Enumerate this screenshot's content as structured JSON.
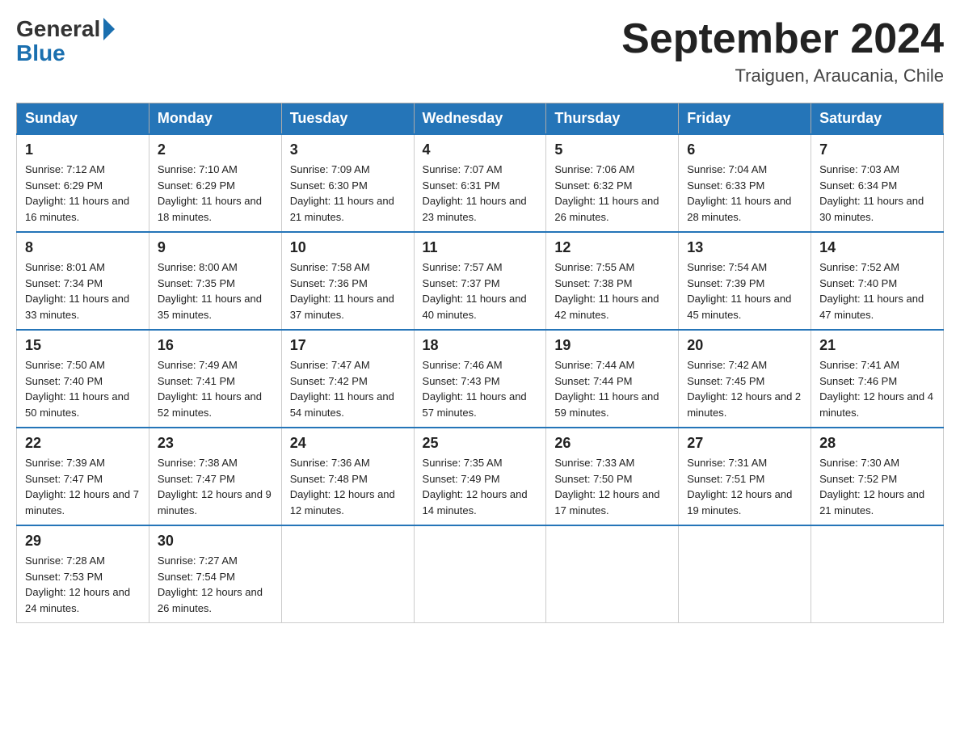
{
  "logo": {
    "general": "General",
    "blue": "Blue"
  },
  "title": {
    "month_year": "September 2024",
    "location": "Traiguen, Araucania, Chile"
  },
  "days_of_week": [
    "Sunday",
    "Monday",
    "Tuesday",
    "Wednesday",
    "Thursday",
    "Friday",
    "Saturday"
  ],
  "weeks": [
    [
      {
        "day": "1",
        "sunrise": "7:12 AM",
        "sunset": "6:29 PM",
        "daylight": "11 hours and 16 minutes."
      },
      {
        "day": "2",
        "sunrise": "7:10 AM",
        "sunset": "6:29 PM",
        "daylight": "11 hours and 18 minutes."
      },
      {
        "day": "3",
        "sunrise": "7:09 AM",
        "sunset": "6:30 PM",
        "daylight": "11 hours and 21 minutes."
      },
      {
        "day": "4",
        "sunrise": "7:07 AM",
        "sunset": "6:31 PM",
        "daylight": "11 hours and 23 minutes."
      },
      {
        "day": "5",
        "sunrise": "7:06 AM",
        "sunset": "6:32 PM",
        "daylight": "11 hours and 26 minutes."
      },
      {
        "day": "6",
        "sunrise": "7:04 AM",
        "sunset": "6:33 PM",
        "daylight": "11 hours and 28 minutes."
      },
      {
        "day": "7",
        "sunrise": "7:03 AM",
        "sunset": "6:34 PM",
        "daylight": "11 hours and 30 minutes."
      }
    ],
    [
      {
        "day": "8",
        "sunrise": "8:01 AM",
        "sunset": "7:34 PM",
        "daylight": "11 hours and 33 minutes."
      },
      {
        "day": "9",
        "sunrise": "8:00 AM",
        "sunset": "7:35 PM",
        "daylight": "11 hours and 35 minutes."
      },
      {
        "day": "10",
        "sunrise": "7:58 AM",
        "sunset": "7:36 PM",
        "daylight": "11 hours and 37 minutes."
      },
      {
        "day": "11",
        "sunrise": "7:57 AM",
        "sunset": "7:37 PM",
        "daylight": "11 hours and 40 minutes."
      },
      {
        "day": "12",
        "sunrise": "7:55 AM",
        "sunset": "7:38 PM",
        "daylight": "11 hours and 42 minutes."
      },
      {
        "day": "13",
        "sunrise": "7:54 AM",
        "sunset": "7:39 PM",
        "daylight": "11 hours and 45 minutes."
      },
      {
        "day": "14",
        "sunrise": "7:52 AM",
        "sunset": "7:40 PM",
        "daylight": "11 hours and 47 minutes."
      }
    ],
    [
      {
        "day": "15",
        "sunrise": "7:50 AM",
        "sunset": "7:40 PM",
        "daylight": "11 hours and 50 minutes."
      },
      {
        "day": "16",
        "sunrise": "7:49 AM",
        "sunset": "7:41 PM",
        "daylight": "11 hours and 52 minutes."
      },
      {
        "day": "17",
        "sunrise": "7:47 AM",
        "sunset": "7:42 PM",
        "daylight": "11 hours and 54 minutes."
      },
      {
        "day": "18",
        "sunrise": "7:46 AM",
        "sunset": "7:43 PM",
        "daylight": "11 hours and 57 minutes."
      },
      {
        "day": "19",
        "sunrise": "7:44 AM",
        "sunset": "7:44 PM",
        "daylight": "11 hours and 59 minutes."
      },
      {
        "day": "20",
        "sunrise": "7:42 AM",
        "sunset": "7:45 PM",
        "daylight": "12 hours and 2 minutes."
      },
      {
        "day": "21",
        "sunrise": "7:41 AM",
        "sunset": "7:46 PM",
        "daylight": "12 hours and 4 minutes."
      }
    ],
    [
      {
        "day": "22",
        "sunrise": "7:39 AM",
        "sunset": "7:47 PM",
        "daylight": "12 hours and 7 minutes."
      },
      {
        "day": "23",
        "sunrise": "7:38 AM",
        "sunset": "7:47 PM",
        "daylight": "12 hours and 9 minutes."
      },
      {
        "day": "24",
        "sunrise": "7:36 AM",
        "sunset": "7:48 PM",
        "daylight": "12 hours and 12 minutes."
      },
      {
        "day": "25",
        "sunrise": "7:35 AM",
        "sunset": "7:49 PM",
        "daylight": "12 hours and 14 minutes."
      },
      {
        "day": "26",
        "sunrise": "7:33 AM",
        "sunset": "7:50 PM",
        "daylight": "12 hours and 17 minutes."
      },
      {
        "day": "27",
        "sunrise": "7:31 AM",
        "sunset": "7:51 PM",
        "daylight": "12 hours and 19 minutes."
      },
      {
        "day": "28",
        "sunrise": "7:30 AM",
        "sunset": "7:52 PM",
        "daylight": "12 hours and 21 minutes."
      }
    ],
    [
      {
        "day": "29",
        "sunrise": "7:28 AM",
        "sunset": "7:53 PM",
        "daylight": "12 hours and 24 minutes."
      },
      {
        "day": "30",
        "sunrise": "7:27 AM",
        "sunset": "7:54 PM",
        "daylight": "12 hours and 26 minutes."
      },
      null,
      null,
      null,
      null,
      null
    ]
  ]
}
